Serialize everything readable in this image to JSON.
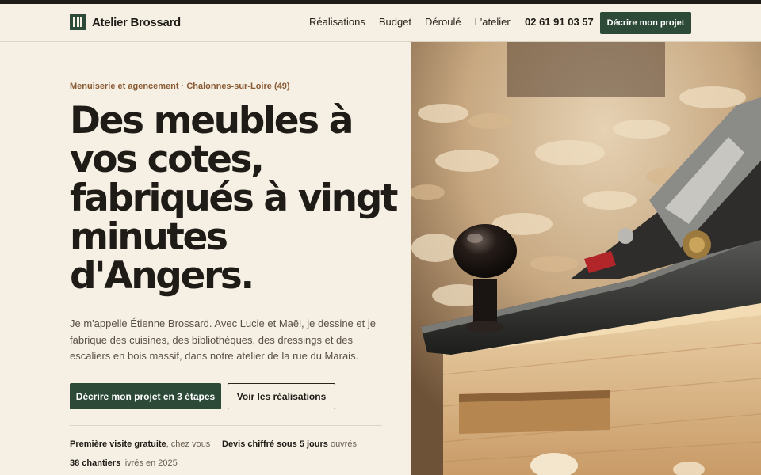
{
  "brand": {
    "name": "Atelier Brossard"
  },
  "nav": {
    "items": [
      "Réalisations",
      "Budget",
      "Déroulé",
      "L'atelier"
    ],
    "phone": "02 61 91 03 57",
    "cta": "Décrire mon projet"
  },
  "hero": {
    "eyebrow": "Menuiserie et agencement · Chalonnes-sur-Loire (49)",
    "title_lines": [
      "Des meubles à",
      "vos cotes,",
      "fabriqués à vingt",
      "minutes",
      "d'Angers."
    ],
    "lead": "Je m'appelle Étienne Brossard. Avec Lucie et Maël, je dessine et je fabrique des cuisines, des bibliothèques, des dressings et des escaliers en bois massif, dans notre atelier de la rue du Marais.",
    "primary_cta": "Décrire mon projet en 3 étapes",
    "secondary_cta": "Voir les réalisations"
  },
  "facts": [
    {
      "strong": "Première visite gratuite",
      "rest": ", chez vous"
    },
    {
      "strong": "Devis chiffré sous 5 jours",
      "rest": " ouvrés"
    },
    {
      "strong": "38 chantiers",
      "rest": " livrés en 2025"
    }
  ],
  "colors": {
    "accent": "#2d4a38",
    "eyebrow": "#8a5a33",
    "background": "#f5efe4"
  }
}
